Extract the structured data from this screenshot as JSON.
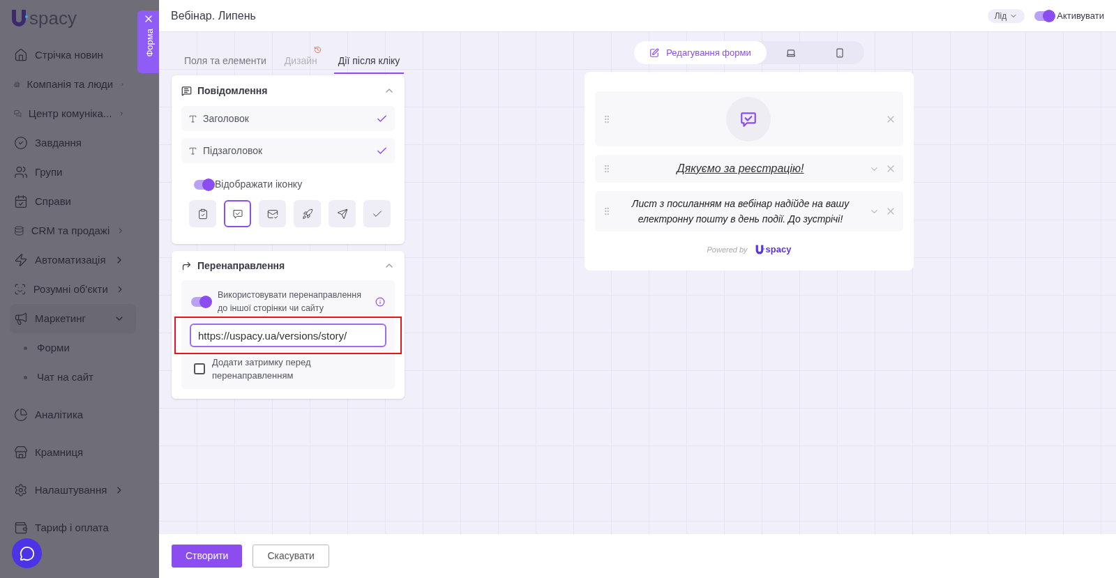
{
  "sidebar": {
    "logo_text": "spacy",
    "form_tab": {
      "label": "Форма"
    },
    "items": [
      {
        "label": "Стрічка новин",
        "kind": "link"
      },
      {
        "label": "Компанія та люди",
        "kind": "group",
        "expanded": false
      },
      {
        "label": "Центр комуніка...",
        "kind": "group",
        "expanded": false
      },
      {
        "label": "Завдання",
        "kind": "link"
      },
      {
        "label": "Групи",
        "kind": "link"
      },
      {
        "label": "Справи",
        "kind": "link"
      },
      {
        "label": "CRM та продажі",
        "kind": "group",
        "expanded": false
      },
      {
        "label": "Автоматизація",
        "kind": "group",
        "expanded": false
      },
      {
        "label": "Розумні об'єкти",
        "kind": "group",
        "expanded": false
      },
      {
        "label": "Маркетинг",
        "kind": "group",
        "expanded": true,
        "children": [
          {
            "label": "Форми"
          },
          {
            "label": "Чат на сайт"
          }
        ]
      },
      {
        "label": "Аналітика",
        "kind": "link"
      },
      {
        "label": "Крамниця",
        "kind": "link"
      },
      {
        "label": "Налаштування",
        "kind": "group",
        "expanded": false
      },
      {
        "label": "Тариф і оплата",
        "kind": "link"
      }
    ]
  },
  "header": {
    "title": "Вебінар. Липень",
    "entity": "Лід",
    "activate": {
      "label": "Активувати",
      "on": true
    }
  },
  "tabs": [
    {
      "label": "Поля та елементи",
      "selected": false,
      "disabled": false,
      "warning": false
    },
    {
      "label": "Дизайн",
      "selected": false,
      "disabled": true,
      "warning": true
    },
    {
      "label": "Дії після кліку",
      "selected": true,
      "disabled": false,
      "warning": false
    }
  ],
  "message_section": {
    "title": "Повідомлення",
    "expanded": true,
    "fields": [
      {
        "label": "Заголовок",
        "checked": true
      },
      {
        "label": "Підзаголовок",
        "checked": true
      }
    ],
    "show_icon": {
      "label": "Відображати іконку",
      "on": true
    },
    "icons": [
      {
        "selected": false
      },
      {
        "selected": true
      },
      {
        "selected": false
      },
      {
        "selected": false
      },
      {
        "selected": false
      },
      {
        "selected": false
      }
    ]
  },
  "redirect_section": {
    "title": "Перенаправлення",
    "expanded": true,
    "use_redirect": {
      "label": "Використовувати перенаправлення до іншої сторінки чи сайту",
      "on": true
    },
    "url": "https://uspacy.ua/versions/story/",
    "highlighted": true,
    "delay": {
      "label": "Додати затримку перед перенаправленням",
      "checked": false
    }
  },
  "preview": {
    "views": [
      {
        "label": "Редагування форми",
        "selected": true
      },
      {
        "selected": false
      },
      {
        "selected": false
      }
    ],
    "title": "Дякуємо за реєстрацію!",
    "subtitle": "Лист з посиланням на вебінар надійде на вашу електронну пошту в день події. До зустрічі!",
    "powered_by": "Powered by",
    "logo_text": "spacy"
  },
  "footer": {
    "buttons": [
      {
        "label": "Створити",
        "kind": "primary"
      },
      {
        "label": "Скасувати",
        "kind": "secondary"
      }
    ]
  }
}
